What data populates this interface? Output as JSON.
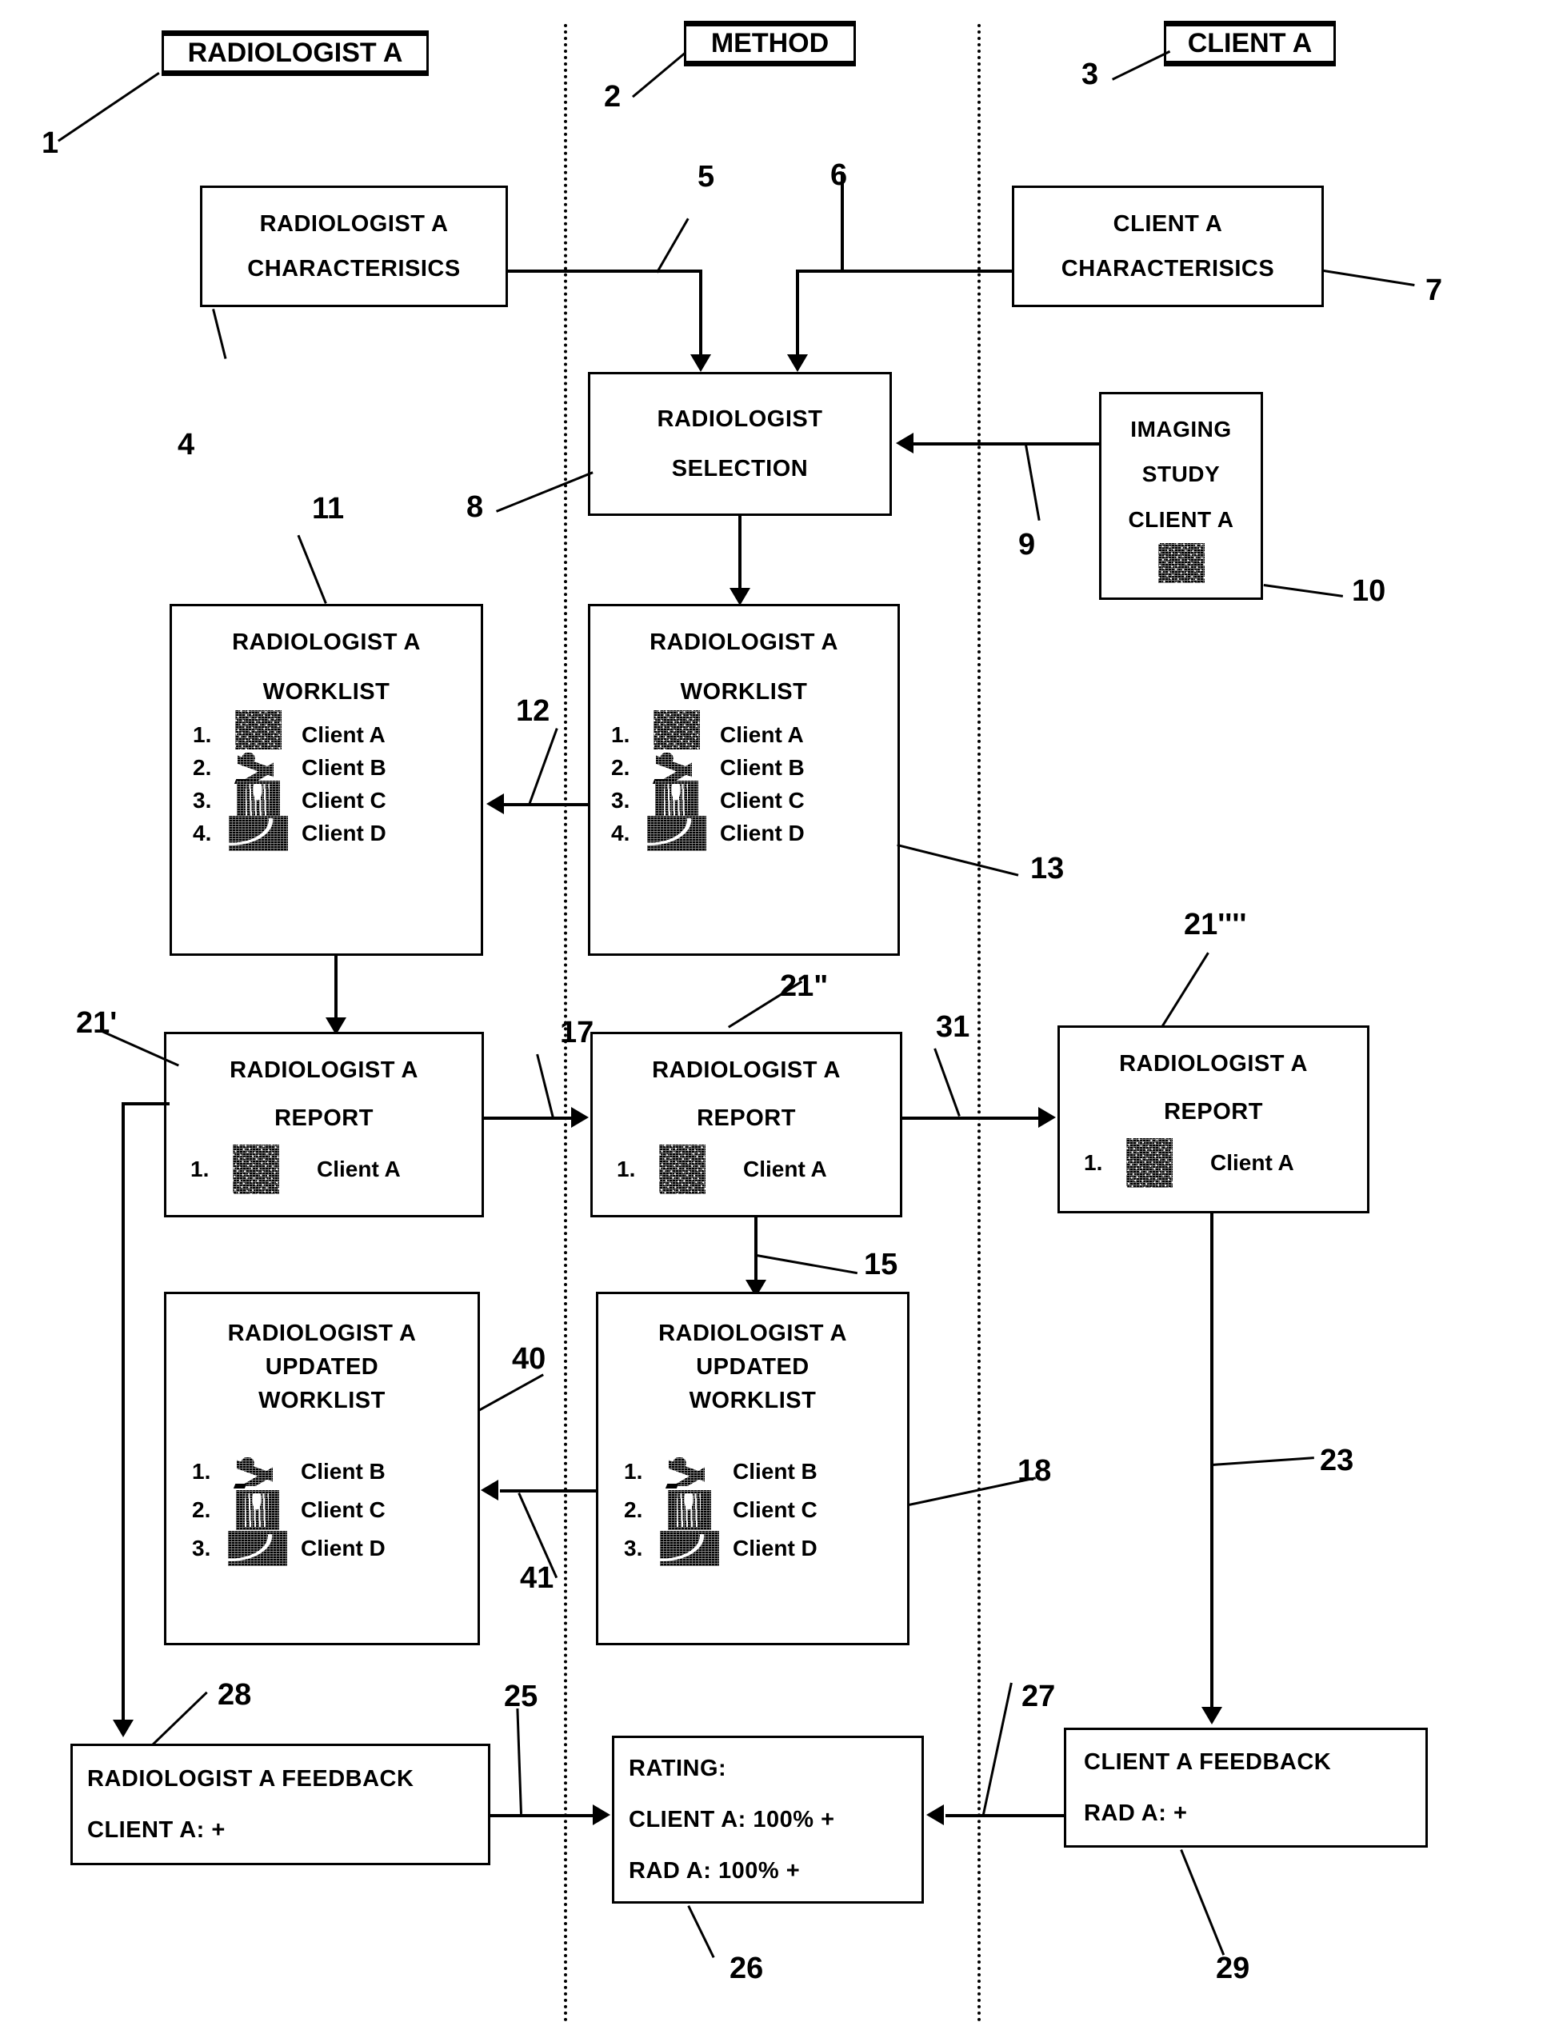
{
  "figure": {
    "columns": [
      {
        "id": "radiologist",
        "label": "RADIOLOGIST A",
        "ref": "1"
      },
      {
        "id": "method",
        "label": "METHOD",
        "ref": "2"
      },
      {
        "id": "client",
        "label": "CLIENT A",
        "ref": "3"
      }
    ]
  },
  "boxes": {
    "rad_char": {
      "line1": "RADIOLOGIST A",
      "line2": "CHARACTERISICS",
      "ref": "4"
    },
    "client_char": {
      "line1": "CLIENT A",
      "line2": "CHARACTERISICS",
      "ref": "7"
    },
    "rad_selection": {
      "line1": "RADIOLOGIST",
      "line2": "SELECTION",
      "ref": "8"
    },
    "imaging_study": {
      "line1": "IMAGING",
      "line2": "STUDY",
      "line3": "CLIENT A",
      "ref": "10"
    },
    "worklist_left": {
      "line1": "RADIOLOGIST A",
      "line2": "WORKLIST",
      "ref": "11"
    },
    "worklist_mid": {
      "line1": "RADIOLOGIST A",
      "line2": "WORKLIST",
      "ref": "13"
    },
    "report_left": {
      "line1": "RADIOLOGIST A",
      "line2": "REPORT",
      "ref": "21'"
    },
    "report_mid": {
      "line1": "RADIOLOGIST A",
      "line2": "REPORT",
      "ref": "21\""
    },
    "report_right": {
      "line1": "RADIOLOGIST A",
      "line2": "REPORT",
      "ref": "21''''"
    },
    "updated_left": {
      "line1": "RADIOLOGIST A",
      "line2": "UPDATED",
      "line3": "WORKLIST",
      "ref": "40"
    },
    "updated_mid": {
      "line1": "RADIOLOGIST A",
      "line2": "UPDATED",
      "line3": "WORKLIST",
      "ref": "18"
    },
    "rad_feedback": {
      "line1": "RADIOLOGIST A FEEDBACK",
      "line2": "CLIENT A: +",
      "ref": "28"
    },
    "rating": {
      "line1": "RATING:",
      "line2": "CLIENT A: 100% +",
      "line3": "RAD A: 100% +",
      "ref": "26"
    },
    "client_feedback": {
      "line1": "CLIENT  A FEEDBACK",
      "line2": "RAD A: +",
      "ref": "29"
    }
  },
  "worklists": {
    "full": [
      {
        "n": "1.",
        "name": "Client A",
        "thumb": "ct-noise-thumbnail"
      },
      {
        "n": "2.",
        "name": "Client B",
        "thumb": "ultrasound-sweep-thumbnail"
      },
      {
        "n": "3.",
        "name": "Client C",
        "thumb": "mri-coronal-thumbnail"
      },
      {
        "n": "4.",
        "name": "Client D",
        "thumb": "waveform-curve-thumbnail"
      }
    ],
    "updated": [
      {
        "n": "1.",
        "name": "Client B",
        "thumb": "ultrasound-sweep-thumbnail"
      },
      {
        "n": "2.",
        "name": "Client C",
        "thumb": "mri-coronal-thumbnail"
      },
      {
        "n": "3.",
        "name": "Client D",
        "thumb": "waveform-curve-thumbnail"
      }
    ],
    "report": [
      {
        "n": "1.",
        "name": "Client A",
        "thumb": "ct-noise-thumbnail"
      }
    ]
  },
  "connector_refs": {
    "r5": "5",
    "r6": "6",
    "r9": "9",
    "r12": "12",
    "r15": "15",
    "r17": "17",
    "r23": "23",
    "r25": "25",
    "r27": "27",
    "r31": "31",
    "r41": "41"
  }
}
